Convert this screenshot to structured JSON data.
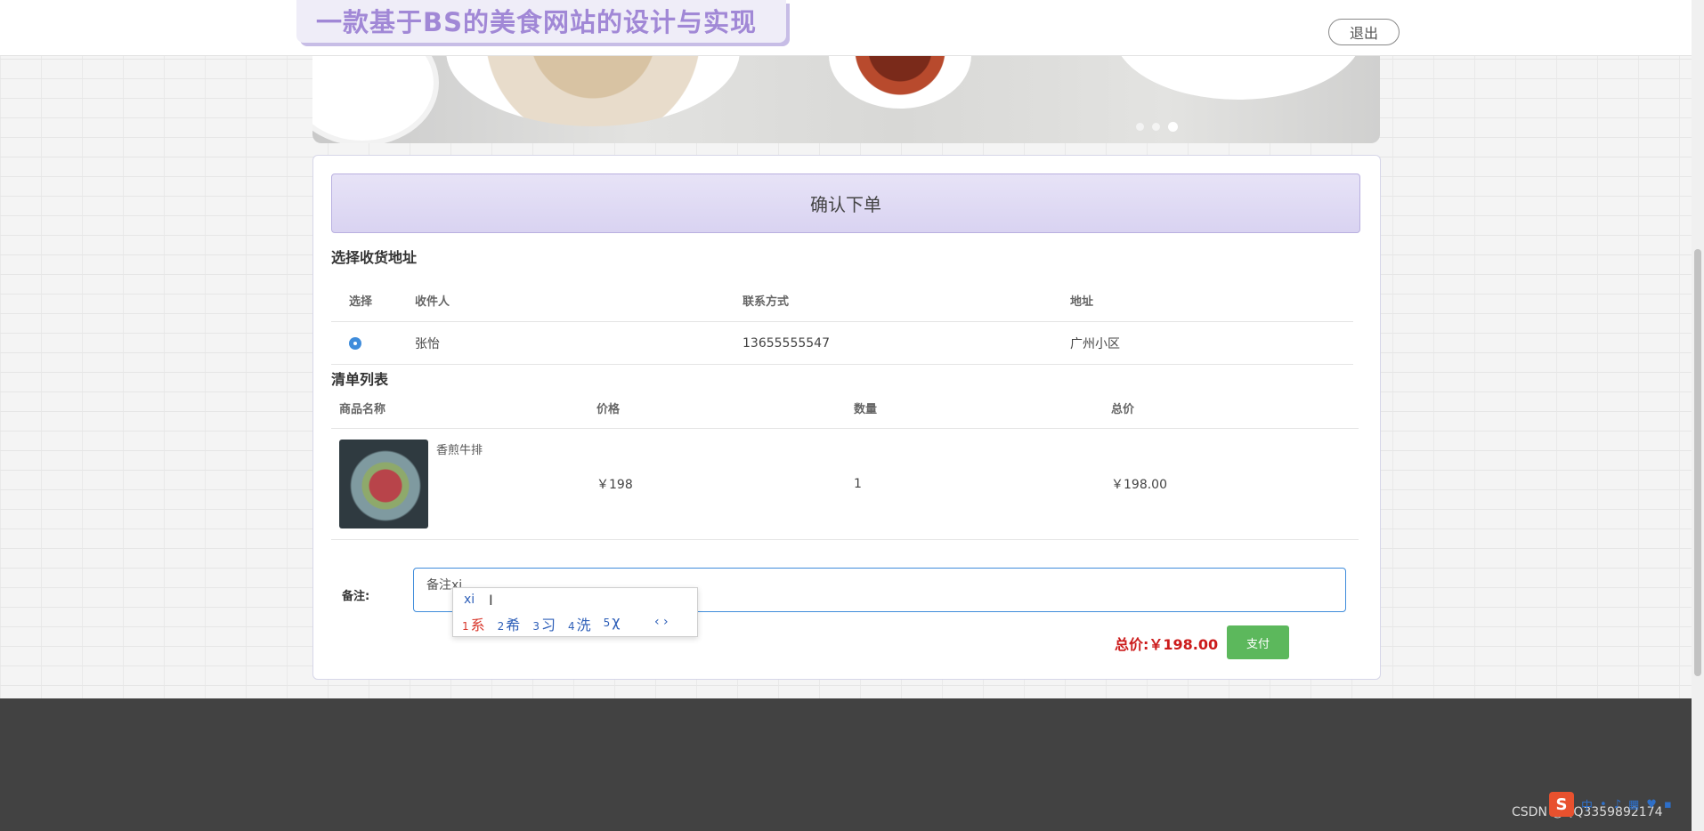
{
  "header": {
    "site_title": "一款基于BS的美食网站的设计与实现",
    "logout_label": "退出"
  },
  "card": {
    "title": "确认下单",
    "address_section": {
      "title": "选择收货地址",
      "columns": [
        "选择",
        "收件人",
        "联系方式",
        "地址"
      ],
      "rows": [
        {
          "selected": true,
          "recipient": "张怡",
          "phone": "13655555547",
          "address": "广州小区"
        }
      ]
    },
    "items_section": {
      "title": "清单列表",
      "columns": [
        "商品名称",
        "价格",
        "数量",
        "总价"
      ],
      "rows": [
        {
          "name": "香煎牛排",
          "price": "￥198",
          "quantity": "1",
          "total": "￥198.00"
        }
      ]
    },
    "remark": {
      "label": "备注:",
      "value": "备注xi"
    },
    "total_label": "总价:",
    "total_value": "￥198.00",
    "pay_label": "支付"
  },
  "ime": {
    "typed": "xi",
    "candidates": [
      {
        "num": "1",
        "text": "系"
      },
      {
        "num": "2",
        "text": "希"
      },
      {
        "num": "3",
        "text": "习"
      },
      {
        "num": "4",
        "text": "洗"
      },
      {
        "num": "5",
        "text": "χ"
      }
    ],
    "nav": "‹ ›"
  },
  "taskbar": {
    "ime_logo": "S",
    "ime_mode": "中"
  },
  "watermark": "CSDN @QQ3359892174",
  "colors": {
    "accent_purple": "#a188d6",
    "pay_green": "#5cb85c",
    "total_red": "#cc1b1b",
    "footer": "#424242"
  }
}
